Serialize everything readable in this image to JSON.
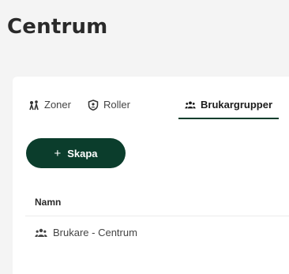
{
  "page": {
    "title": "Centrum"
  },
  "tabs": [
    {
      "label": "Zoner",
      "icon": "zones-icon",
      "active": false
    },
    {
      "label": "Roller",
      "icon": "shield-user-icon",
      "active": false
    },
    {
      "label": "Brukargrupper",
      "icon": "user-group-icon",
      "active": true
    }
  ],
  "toolbar": {
    "create_plus": "+",
    "create_label": "Skapa"
  },
  "table": {
    "columns": [
      "Namn"
    ],
    "rows": [
      {
        "icon": "user-group-icon",
        "name": "Brukare - Centrum"
      }
    ]
  },
  "colors": {
    "accent": "#0b3d2c",
    "background": "#f4f4f4",
    "card": "#ffffff"
  }
}
